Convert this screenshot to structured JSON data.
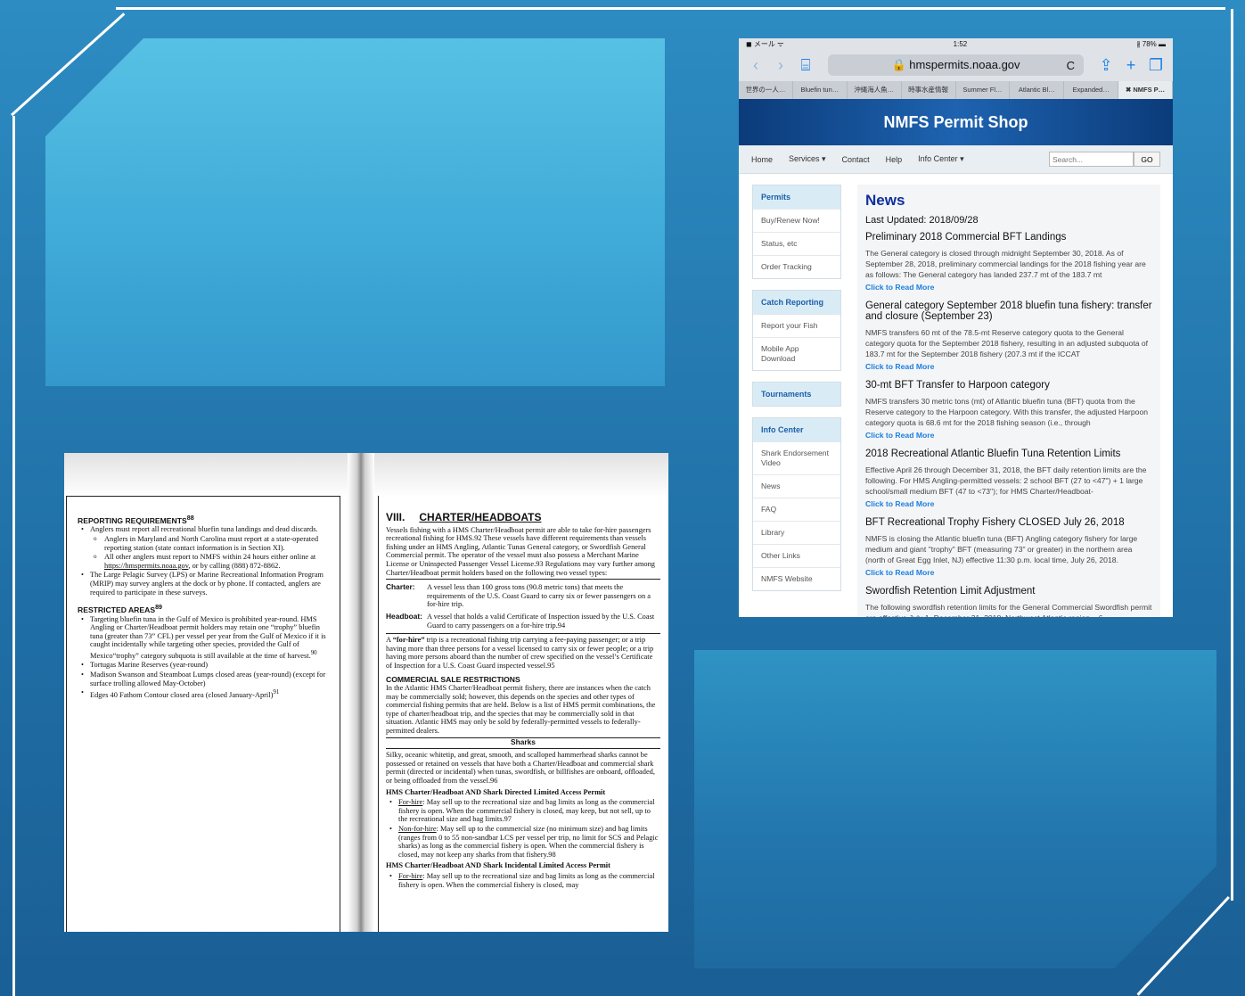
{
  "phone": {
    "status": {
      "left": "◼ メール ᯤ",
      "time": "1:52",
      "battery": "∦ 78% ▬"
    },
    "browser": {
      "url": "🔒 hmspermits.noaa.gov",
      "reload": "C"
    },
    "tabs": [
      "世界の一人…",
      "Bluefin tun…",
      "沖縄海人魚…",
      "時事水産情報",
      "Summer Fl…",
      "Atlantic Bl…",
      "Expanded…",
      "✖ NMFS P…"
    ],
    "site_title": "NMFS Permit Shop",
    "menu": {
      "home": "Home",
      "services": "Services ▾",
      "contact": "Contact",
      "help": "Help",
      "info_center": "Info Center ▾",
      "search_placeholder": "Search...",
      "go": "GO"
    },
    "sidebar": [
      {
        "head": "Permits",
        "items": [
          "Buy/Renew Now!",
          "Status, etc",
          "Order Tracking"
        ]
      },
      {
        "head": "Catch Reporting",
        "items": [
          "Report your Fish",
          "Mobile App Download"
        ]
      },
      {
        "head": "Tournaments",
        "items": []
      },
      {
        "head": "Info Center",
        "items": [
          "Shark Endorsement Video",
          "News",
          "FAQ",
          "Library",
          "Other Links",
          "NMFS Website"
        ]
      }
    ],
    "news": {
      "heading": "News",
      "updated": "Last Updated: 2018/09/28",
      "read_more": "Click to Read More",
      "items": [
        {
          "title": "Preliminary 2018 Commercial BFT Landings",
          "body": "The General category is closed through midnight September 30, 2018. As of September 28, 2018, preliminary commercial landings for the 2018 fishing year are as follows: The General category has landed 237.7 mt of the 183.7 mt"
        },
        {
          "title": "General category September 2018 bluefin tuna fishery: transfer and closure (September 23)",
          "body": "NMFS transfers 60 mt of the 78.5-mt Reserve category quota to the General category quota for the September 2018 fishery, resulting in an adjusted subquota of 183.7 mt for the September 2018 fishery (207.3 mt if the ICCAT"
        },
        {
          "title": "30-mt BFT Transfer to Harpoon category",
          "body": "NMFS transfers 30 metric tons (mt) of Atlantic bluefin tuna (BFT) quota from the Reserve category to the Harpoon category. With this transfer, the adjusted Harpoon category quota is 68.6 mt for the 2018 fishing season (i.e., through"
        },
        {
          "title": "2018 Recreational Atlantic Bluefin Tuna Retention Limits",
          "body": "Effective April 26 through December 31, 2018, the BFT daily retention limits are the following. For HMS Angling-permitted vessels: 2 school BFT (27 to <47\") + 1 large school/small medium BFT (47 to <73\"); for HMS Charter/Headboat-"
        },
        {
          "title": "BFT Recreational Trophy Fishery CLOSED July 26, 2018",
          "body": "NMFS is closing the Atlantic bluefin tuna (BFT) Angling category fishery for large medium and giant \"trophy\" BFT (measuring 73\" or greater) in the northern area (north of Great Egg Inlet, NJ) effective 11:30 p.m. local time, July 26, 2018."
        },
        {
          "title": "Swordfish Retention Limit Adjustment",
          "body": "The following swordfish retention limits for the General Commercial Swordfish permit are effective July 1- December 31, 2018: Northwest Atlantic region – 6"
        }
      ]
    }
  },
  "doc": {
    "left": {
      "h1": "REPORTING REQUIREMENTS",
      "h1_sup": "88",
      "r1": "Anglers must report all recreational bluefin tuna landings and dead discards.",
      "r1a": "Anglers in Maryland and North Carolina must report at a state-operated reporting station (state contact information is in Section XI).",
      "r1b_pre": "All other anglers must report to NMFS within 24 hours either online at ",
      "r1b_link": "https://hmspermits.noaa.gov",
      "r1b_post": ", or by calling (888) 872-8862.",
      "r2": "The Large Pelagic Survey (LPS) or Marine Recreational Information Program (MRIP) may survey anglers at the dock or by phone.  If contacted, anglers are required to participate in these surveys.",
      "h2": "RESTRICTED AREAS",
      "h2_sup": "89",
      "a1": "Targeting bluefin tuna in the Gulf of Mexico is prohibited year-round. HMS Angling or Charter/Headboat permit holders may retain one “trophy” bluefin tuna (greater than 73” CFL) per vessel per year from the Gulf of Mexico if it is caught incidentally while targeting other species, provided the Gulf of Mexico“trophy” category subquota is still available at the time of harvest.",
      "a1_sup": "90",
      "a2": "Tortugas Marine Reserves (year-round)",
      "a3": "Madison Swanson and Steamboat Lumps closed areas (year-round) (except for surface trolling allowed May-October)",
      "a4": "Edges 40 Fathom Contour closed area (closed January-April)",
      "a4_sup": "91"
    },
    "right": {
      "num": "VIII.",
      "title": "CHARTER/HEADBOATS",
      "intro": "Vessels fishing with a HMS Charter/Headboat permit are able to take for-hire passengers recreational fishing for HMS.92  These vessels have different requirements than vessels fishing under an HMS Angling, Atlantic Tunas General category, or Swordfish General Commercial permit.  The operator of the vessel must also possess a Merchant Marine License or Uninspected Passenger Vessel License.93  Regulations may vary further among Charter/Headboat permit holders based on the following two vessel types:",
      "charter_lbl": "Charter:",
      "charter": "A vessel less than 100 gross tons (90.8 metric tons) that meets the requirements of the U.S. Coast Guard to carry six or fewer passengers on a for-hire trip.",
      "headboat_lbl": "Headboat:",
      "headboat": "A vessel that holds a valid Certificate of Inspection issued by the U.S. Coast Guard to carry passengers on a for-hire trip.94",
      "forhire_pre": "A ",
      "forhire_bold": "“for-hire”",
      "forhire": " trip is a recreational fishing trip carrying a fee-paying passenger; or a trip having more than three persons for a vessel licensed to carry six or fewer people; or a trip having more persons aboard than the number of crew specified on the vessel’s Certificate of Inspection for a U.S. Coast Guard inspected vessel.95",
      "csr_head": "COMMERCIAL SALE RESTRICTIONS",
      "csr": "In the Atlantic HMS Charter/Headboat permit fishery, there are instances when the catch may be commercially sold; however, this depends on the species and other types of commercial fishing permits that are held.  Below is a list of HMS permit combinations, the type of charter/headboat trip, and the species that may be commercially sold in that situation.  Atlantic HMS may only be sold by federally-permitted vessels to federally-permitted dealers.",
      "sharks": "Sharks",
      "sharks_p": "Silky, oceanic whitetip, and great, smooth, and scalloped hammerhead sharks cannot be possessed or retained on vessels that have both a Charter/Headboat and commercial shark permit (directed or incidental) when tunas, swordfish, or billfishes are onboard, offloaded, or being offloaded from the vessel.96",
      "p1_head": "HMS Charter/Headboat AND Shark Directed Limited Access Permit",
      "p1a_u": "For-hire",
      "p1a": ": May sell up to the recreational size and bag limits as long as the commercial fishery is open.  When the commercial fishery is closed, may keep, but not sell, up to the recreational size and bag limits.97",
      "p1b_u": "Non-for-hire",
      "p1b": ": May sell up to the commercial size (no minimum size) and bag limits (ranges from 0 to 55 non-sandbar LCS per vessel per trip, no limit for SCS and Pelagic sharks) as long as the commercial fishery is open.  When the commercial fishery is closed, may not keep any sharks from that fishery.98",
      "p2_head": "HMS Charter/Headboat AND Shark Incidental Limited Access Permit",
      "p2a_u": "For-hire",
      "p2a": ": May sell up to the recreational size and bag limits as long as the commercial fishery is open.  When the commercial fishery is closed, may"
    }
  }
}
